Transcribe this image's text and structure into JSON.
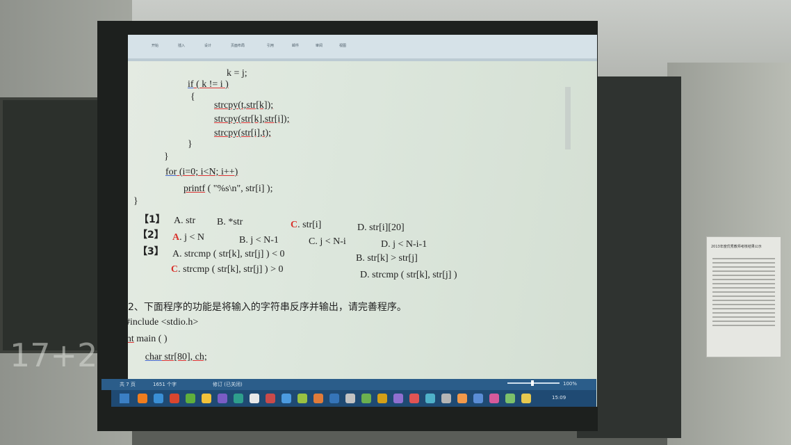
{
  "board": {
    "chalk_text": "17+2)"
  },
  "notice": {
    "title": "2013年度优秀教师考核结果公示"
  },
  "ribbon": {
    "tabs": [
      "开始",
      "插入",
      "设计",
      "页面布局",
      "引用",
      "邮件",
      "审阅",
      "视图"
    ]
  },
  "code": {
    "l1": "k = j;",
    "l2a": "if",
    "l2b": " ( k != i )",
    "l3": "{",
    "l4": "strcpy(t,str[k]);",
    "l5": "strcpy(str[k],str[i]);",
    "l6": "strcpy(str[i],t);",
    "l7": "}",
    "l8": "}",
    "l9a": "for",
    "l9b": " (i=0; i<N; i++)",
    "l10a": "printf",
    "l10b": " ( \"%s\\n\", str[i] );",
    "l11": "}"
  },
  "answers": {
    "q1": {
      "label": "【1】",
      "a": "A. str",
      "b": "B. *str",
      "c_letter": "C",
      "c": ". str[i]",
      "d": "D. str[i][20]"
    },
    "q2": {
      "label": "【2】",
      "a_letter": "A",
      "a": ". j < N",
      "b": "B. j < N-1",
      "c": "C. j < N-i",
      "d": "D. j < N-i-1"
    },
    "q3": {
      "label": "【3】",
      "a": "A. strcmp ( str[k], str[j] ) < 0",
      "b": "B. str[k] > str[j]",
      "c_letter": "C",
      "c": ". strcmp ( str[k], str[j] ) > 0",
      "d": "D. strcmp ( str[k], str[j] )"
    }
  },
  "question2": {
    "prompt": "2、下面程序的功能是将输入的字符串反序并输出，请完善程序。",
    "include": "#include <stdio.h>",
    "main_a": "int",
    "main_b": " main ( )",
    "decl_brace": "{",
    "decl_a": "char",
    "decl_b": " str[80], ch;"
  },
  "statusbar": {
    "pages": "共 7 页",
    "words": "1651 个字",
    "mode": "修订 (已关闭)",
    "zoom": "100%"
  },
  "taskbar": {
    "clock": "15:09",
    "icon_colors": [
      "#f07d1e",
      "#3a8fd6",
      "#d9462f",
      "#5fae3c",
      "#f2c23a",
      "#7a5cc4",
      "#2e9e8c",
      "#e8e8e8",
      "#c94a4a",
      "#4c9be0",
      "#9ac142",
      "#e07b39",
      "#3574b8",
      "#c2c2c2",
      "#6bb04f",
      "#d4a017",
      "#8f6fd0",
      "#e05454",
      "#4fb1c9",
      "#b5b5b5",
      "#f2994a",
      "#5a8dd6",
      "#d65a9b",
      "#7cc06a",
      "#e6c84f"
    ]
  }
}
